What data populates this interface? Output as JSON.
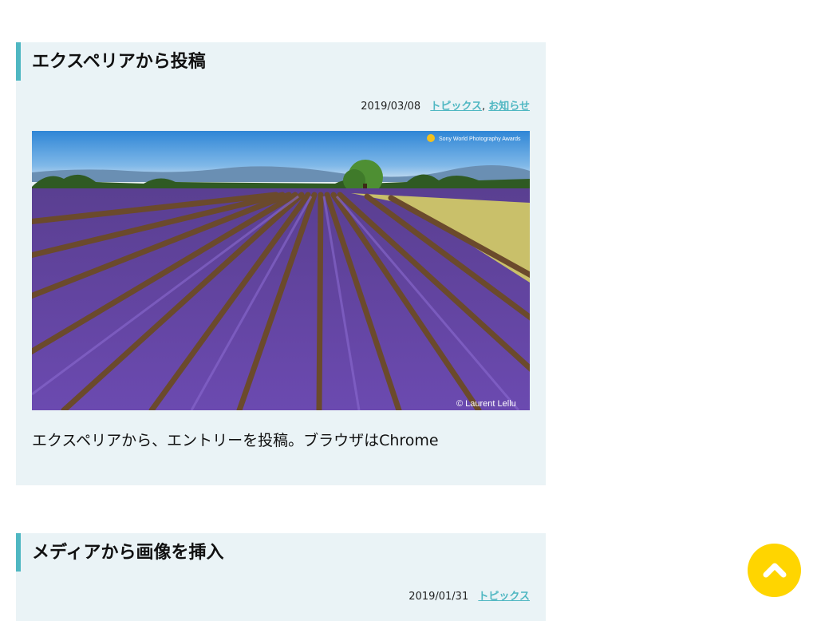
{
  "posts": [
    {
      "title": "エクスペリアから投稿",
      "date": "2019/03/08",
      "categories": [
        "トピックス",
        "お知らせ"
      ],
      "image": {
        "alt": "lavender field",
        "watermark_top": "Sony World Photography Awards",
        "credit": "© Laurent Lellu"
      },
      "excerpt": "エクスペリアから、エントリーを投稿。ブラウザはChrome"
    },
    {
      "title": "メディアから画像を挿入",
      "date": "2019/01/31",
      "categories": [
        "トピックス"
      ]
    }
  ],
  "category_separator": ",",
  "scroll_top": {
    "icon": "chevron-up-icon",
    "color": "#ffd500"
  },
  "colors": {
    "accent": "#4fb7c2",
    "card_bg": "#eaf3f6"
  }
}
